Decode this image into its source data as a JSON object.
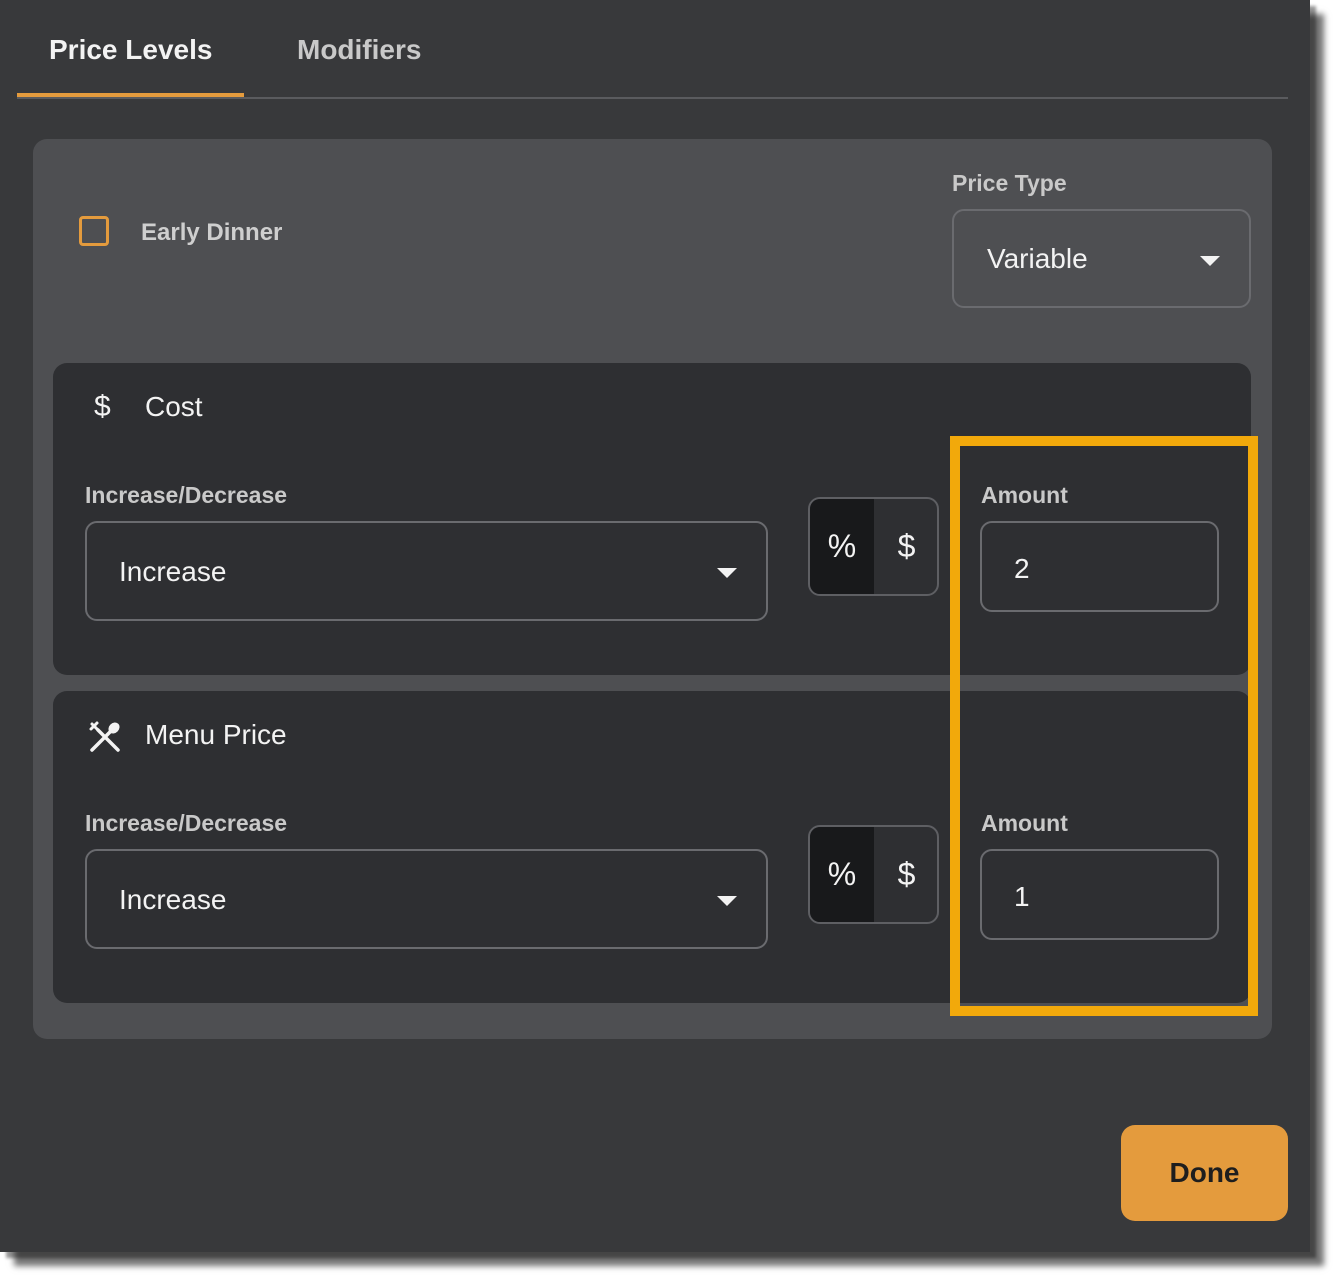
{
  "tabs": [
    {
      "label": "Price Levels",
      "active": true
    },
    {
      "label": "Modifiers",
      "active": false
    }
  ],
  "price_level": {
    "name": "Early Dinner",
    "checked": false,
    "price_type_label": "Price Type",
    "price_type_value": "Variable"
  },
  "cost": {
    "title": "Cost",
    "icon": "dollar-icon",
    "increase_decrease_label": "Increase/Decrease",
    "increase_decrease_value": "Increase",
    "unit_options": [
      "%",
      "$"
    ],
    "selected_unit": "%",
    "amount_label": "Amount",
    "amount_value": "2"
  },
  "menu_price": {
    "title": "Menu Price",
    "icon": "utensils-icon",
    "increase_decrease_label": "Increase/Decrease",
    "increase_decrease_value": "Increase",
    "unit_options": [
      "%",
      "$"
    ],
    "selected_unit": "%",
    "amount_label": "Amount",
    "amount_value": "1"
  },
  "done_label": "Done",
  "colors": {
    "accent": "#e49b3d",
    "highlight": "#f2a90b",
    "background": "#38393b",
    "panel": "#4e4f52",
    "card": "#2e2f32"
  }
}
